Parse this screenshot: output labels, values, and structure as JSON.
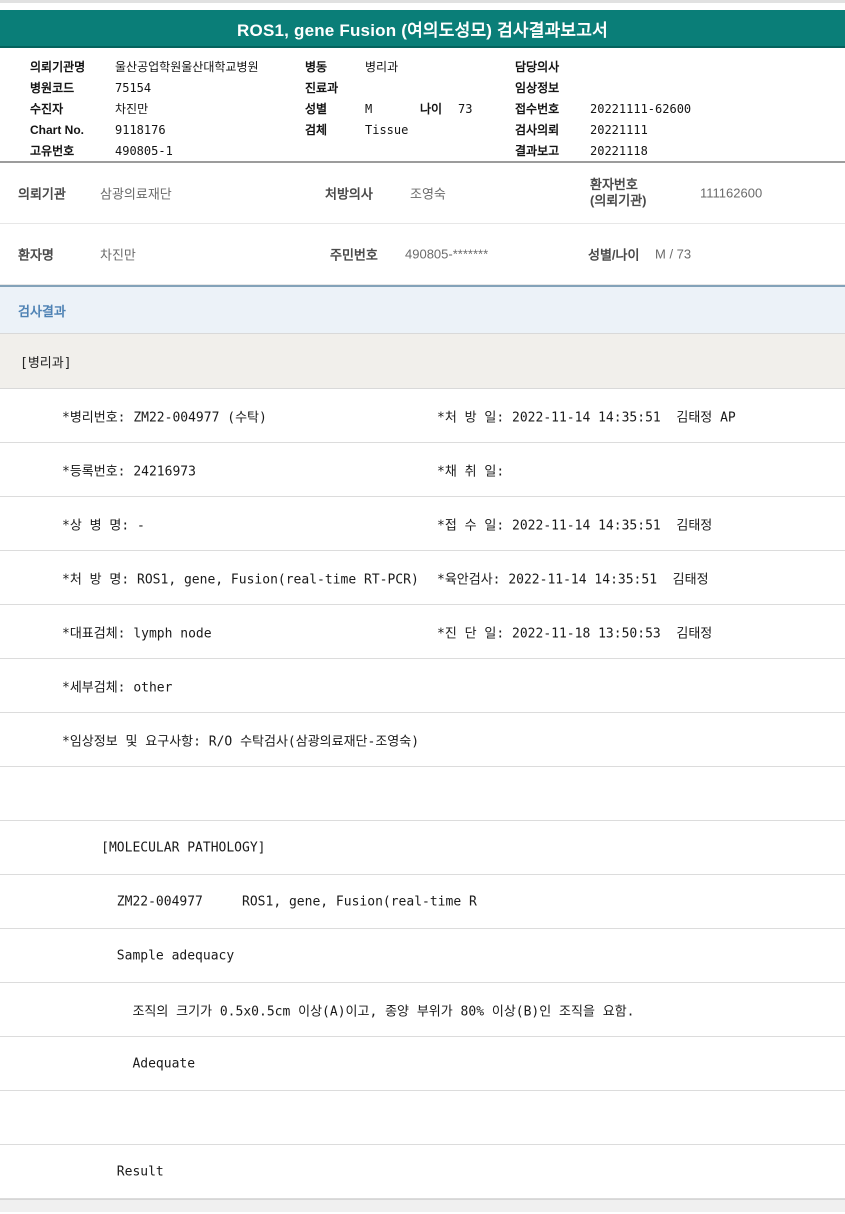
{
  "page": {
    "title": "ROS1, gene Fusion (여의도성모) 검사결과보고서"
  },
  "header_info": {
    "col1": [
      {
        "label": "의뢰기관명",
        "value": "울산공업학원울산대학교병원"
      },
      {
        "label": "병원코드",
        "value": "75154"
      },
      {
        "label": "수진자",
        "value": "차진만"
      },
      {
        "label": "Chart No.",
        "value": "9118176"
      },
      {
        "label": "고유번호",
        "value": "490805-1"
      }
    ],
    "col2": [
      {
        "label": "병동",
        "value": "병리과"
      },
      {
        "label": "진료과",
        "value": ""
      },
      {
        "label": "성별",
        "value": "M",
        "label2": "나이",
        "value2": "73"
      },
      {
        "label": "검체",
        "value": "Tissue"
      },
      {
        "label": "",
        "value": ""
      }
    ],
    "col3": [
      {
        "label": "담당의사",
        "value": ""
      },
      {
        "label": "임상정보",
        "value": ""
      },
      {
        "label": "접수번호",
        "value": "20221111-62600"
      },
      {
        "label": "검사의뢰",
        "value": "20221111"
      },
      {
        "label": "결과보고",
        "value": "20221118"
      }
    ]
  },
  "patient": {
    "referral_org_label": "의뢰기관",
    "referral_org": "삼광의료재단",
    "prescribing_doctor_label": "처방의사",
    "prescribing_doctor": "조영숙",
    "patient_no_label_line1": "환자번호",
    "patient_no_label_line2": "(의뢰기관)",
    "patient_no": "111162600",
    "patient_name_label": "환자명",
    "patient_name": "차진만",
    "resident_no_label": "주민번호",
    "resident_no": "490805-*******",
    "sex_age_label": "성별/나이",
    "sex_age": "M / 73"
  },
  "results": {
    "section_title": "검사결과",
    "department": "[병리과]",
    "rows": [
      {
        "left": "*병리번호: ZM22-004977 (수탁)",
        "right": "*처 방 일: 2022-11-14 14:35:51  김태정 AP"
      },
      {
        "left": "*등록번호: 24216973",
        "right": "*채 취 일:"
      },
      {
        "left": "*상 병 명: -",
        "right": "*접 수 일: 2022-11-14 14:35:51  김태정"
      },
      {
        "left": "*처 방 명: ROS1, gene, Fusion(real-time RT-PCR)",
        "right": "*육안검사: 2022-11-14 14:35:51  김태정"
      },
      {
        "left": "*대표검체: lymph node",
        "right": "*진 단 일: 2022-11-18 13:50:53  김태정"
      },
      {
        "left": "*세부검체: other",
        "right": ""
      },
      {
        "left": "*임상정보 및 요구사항: R/O 수탁검사(삼광의료재단-조영숙)",
        "right": ""
      },
      {
        "left": "",
        "right": ""
      },
      {
        "left": "     [MOLECULAR PATHOLOGY]",
        "right": ""
      },
      {
        "left": "       ZM22-004977     ROS1, gene, Fusion(real-time R",
        "right": ""
      },
      {
        "left": "       Sample adequacy",
        "right": ""
      },
      {
        "left": "         조직의 크기가 0.5x0.5cm 이상(A)이고, 종양 부위가 80% 이상(B)인 조직을 요함.",
        "right": ""
      },
      {
        "left": "         Adequate",
        "right": ""
      },
      {
        "left": "",
        "right": ""
      },
      {
        "left": "       Result",
        "right": ""
      }
    ]
  },
  "colors": {
    "header_teal": "#0a7e78",
    "section_blue_text": "#4e82b4",
    "section_bg": "#ecf2f8",
    "dept_row_bg": "#f1efeb"
  }
}
